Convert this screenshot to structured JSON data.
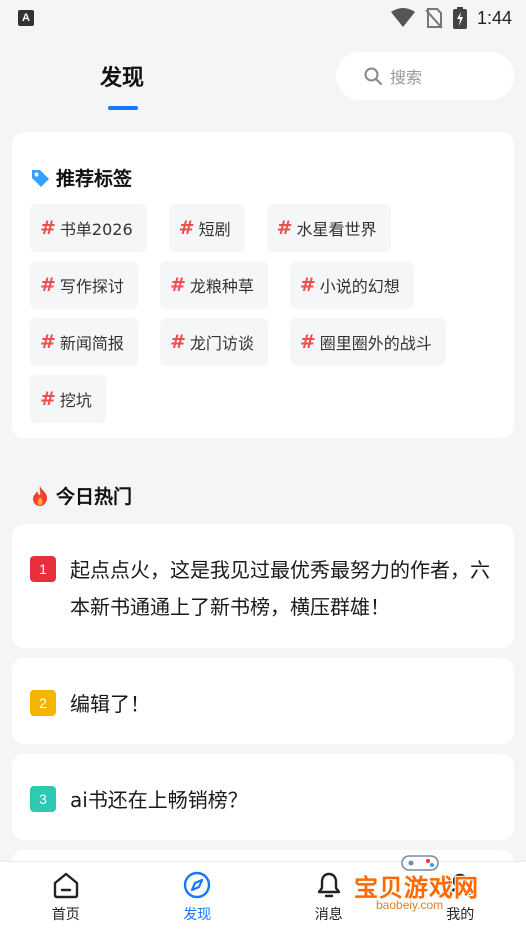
{
  "status_bar": {
    "time": "1:44"
  },
  "header": {
    "title": "发现",
    "search_placeholder": "搜索"
  },
  "tags_section": {
    "title": "推荐标签",
    "tags": [
      {
        "label": "书单2026"
      },
      {
        "label": "短剧"
      },
      {
        "label": "水星看世界"
      },
      {
        "label": "写作探讨"
      },
      {
        "label": "龙粮种草"
      },
      {
        "label": "小说的幻想"
      },
      {
        "label": "新闻简报"
      },
      {
        "label": "龙门访谈"
      },
      {
        "label": "圈里圈外的战斗"
      },
      {
        "label": "挖坑"
      }
    ],
    "hash": "#"
  },
  "hot_section": {
    "title": "今日热门",
    "items": [
      {
        "rank": "1",
        "color": "#e8303a",
        "text": "起点点火，这是我见过最优秀最努力的作者，六本新书通通上了新书榜，横压群雄！"
      },
      {
        "rank": "2",
        "color": "#f5b400",
        "text": "编辑了！"
      },
      {
        "rank": "3",
        "color": "#2dc9b2",
        "text": "ai书还在上畅销榜？"
      }
    ]
  },
  "bottom_nav": {
    "items": [
      {
        "label": "首页"
      },
      {
        "label": "发现"
      },
      {
        "label": "消息"
      },
      {
        "label": "我的"
      }
    ],
    "active_color": "#1677ff"
  },
  "watermark": {
    "text": "宝贝游戏网",
    "domain": "baobeiy.com"
  },
  "colors": {
    "accent": "#1677ff",
    "tag_hash": "#f04e4e",
    "background": "#f4f5f7"
  }
}
